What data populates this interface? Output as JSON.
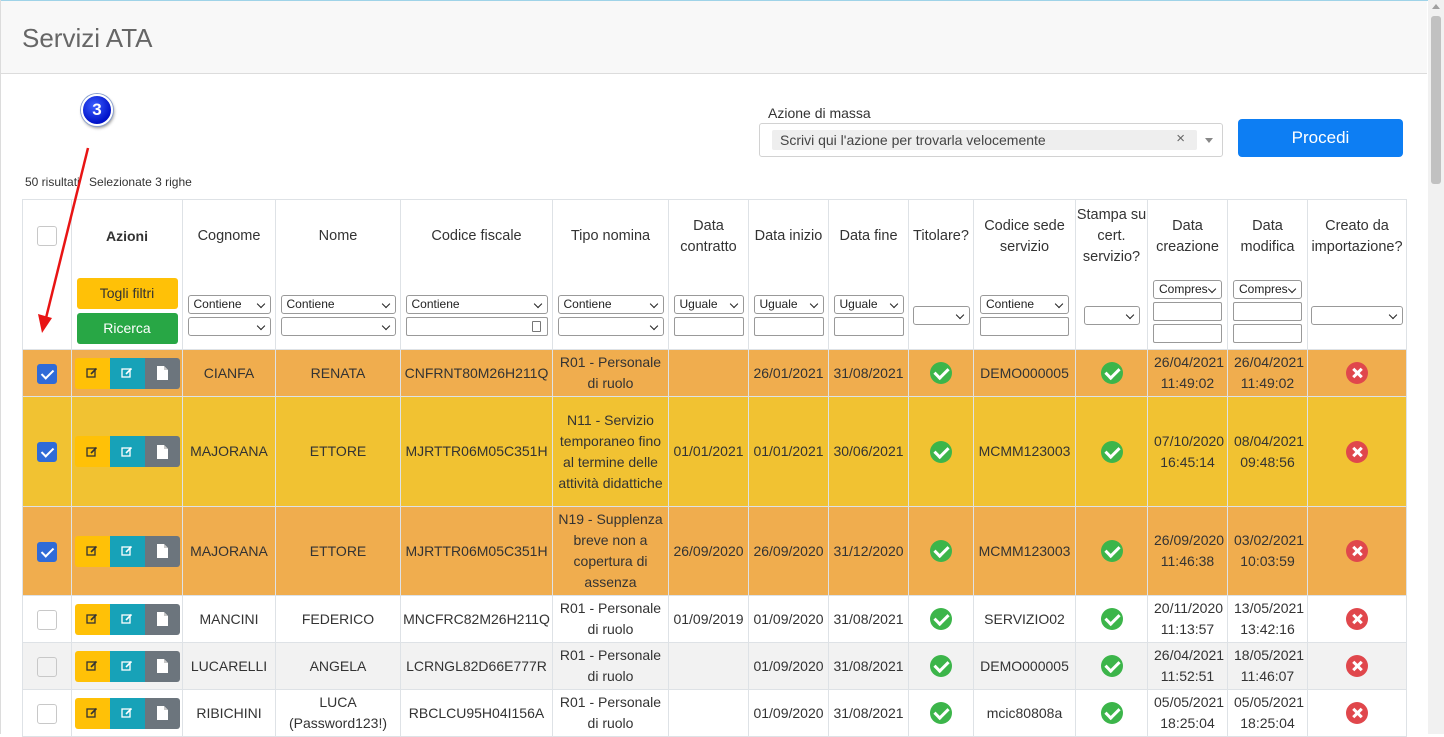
{
  "page": {
    "title": "Servizi ATA"
  },
  "mass_action": {
    "label": "Azione di massa",
    "placeholder": "Scrivi qui l'azione per trovarla velocemente",
    "clear": "×",
    "submit_label": "Procedi"
  },
  "results": {
    "count_text": "50 risultati",
    "selected_text": "Selezionate 3 righe"
  },
  "annotation": {
    "marker": "3"
  },
  "headers": {
    "azioni": "Azioni",
    "cognome": "Cognome",
    "nome": "Nome",
    "codice_fiscale": "Codice fiscale",
    "tipo_nomina": "Tipo nomina",
    "data_contratto": "Data contratto",
    "data_inizio": "Data inizio",
    "data_fine": "Data fine",
    "titolare": "Titolare?",
    "codice_sede": "Codice sede servizio",
    "stampa": "Stampa su cert. servizio?",
    "data_creazione": "Data creazione",
    "data_modifica": "Data modifica",
    "creato_importazione": "Creato da importazione?"
  },
  "filters": {
    "togli_filtri": "Togli filtri",
    "ricerca": "Ricerca",
    "contiene": "Contiene",
    "uguale": "Uguale",
    "compres": "Compres"
  },
  "rows": [
    {
      "checked": true,
      "cognome": "CIANFA",
      "nome": "RENATA",
      "cf": "CNFRNT80M26H211Q",
      "tipo": "R01 - Personale di ruolo",
      "data_contratto": "",
      "data_inizio": "26/01/2021",
      "data_fine": "31/08/2021",
      "titolare": true,
      "sede": "DEMO000005",
      "stampa": true,
      "creazione": "26/04/2021 11:49:02",
      "modifica": "26/04/2021 11:49:02",
      "importazione": false
    },
    {
      "checked": true,
      "cognome": "MAJORANA",
      "nome": "ETTORE",
      "cf": "MJRTTR06M05C351H",
      "tipo": "N11 - Servizio temporaneo fino al termine delle attività didattiche",
      "data_contratto": "01/01/2021",
      "data_inizio": "01/01/2021",
      "data_fine": "30/06/2021",
      "titolare": true,
      "sede": "MCMM123003",
      "stampa": true,
      "creazione": "07/10/2020 16:45:14",
      "modifica": "08/04/2021 09:48:56",
      "importazione": false
    },
    {
      "checked": true,
      "cognome": "MAJORANA",
      "nome": "ETTORE",
      "cf": "MJRTTR06M05C351H",
      "tipo": "N19 - Supplenza breve non a copertura di assenza",
      "data_contratto": "26/09/2020",
      "data_inizio": "26/09/2020",
      "data_fine": "31/12/2020",
      "titolare": true,
      "sede": "MCMM123003",
      "stampa": true,
      "creazione": "26/09/2020 11:46:38",
      "modifica": "03/02/2021 10:03:59",
      "importazione": false
    },
    {
      "checked": false,
      "cognome": "MANCINI",
      "nome": "FEDERICO",
      "cf": "MNCFRC82M26H211Q",
      "tipo": "R01 - Personale di ruolo",
      "data_contratto": "01/09/2019",
      "data_inizio": "01/09/2020",
      "data_fine": "31/08/2021",
      "titolare": true,
      "sede": "SERVIZIO02",
      "stampa": true,
      "creazione": "20/11/2020 11:13:57",
      "modifica": "13/05/2021 13:42:16",
      "importazione": false
    },
    {
      "checked": false,
      "cognome": "LUCARELLI",
      "nome": "ANGELA",
      "cf": "LCRNGL82D66E777R",
      "tipo": "R01 - Personale di ruolo",
      "data_contratto": "",
      "data_inizio": "01/09/2020",
      "data_fine": "31/08/2021",
      "titolare": true,
      "sede": "DEMO000005",
      "stampa": true,
      "creazione": "26/04/2021 11:52:51",
      "modifica": "18/05/2021 11:46:07",
      "importazione": false
    },
    {
      "checked": false,
      "cognome": "RIBICHINI",
      "nome": "LUCA (Password123!)",
      "cf": "RBCLCU95H04I156A",
      "tipo": "R01 - Personale di ruolo",
      "data_contratto": "",
      "data_inizio": "01/09/2020",
      "data_fine": "31/08/2021",
      "titolare": true,
      "sede": "mcic80808a",
      "stampa": true,
      "creazione": "05/05/2021 18:25:04",
      "modifica": "05/05/2021 18:25:04",
      "importazione": false
    }
  ]
}
